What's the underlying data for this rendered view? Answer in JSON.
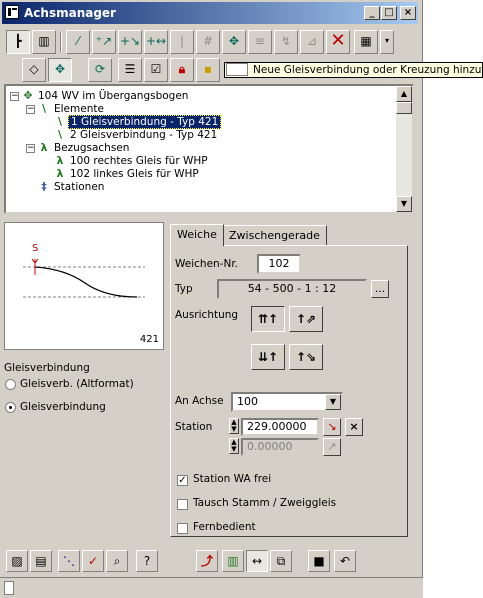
{
  "window": {
    "title": "Achsmanager",
    "caption_buttons": [
      "_",
      "□",
      "×"
    ]
  },
  "tooltip": "Neue Gleisverbindung oder Kreuzung hinzufügen",
  "tree": {
    "nodes": [
      {
        "label": "104 WV im Übergangsbogen",
        "expanded": true
      },
      {
        "label": "Elemente",
        "expanded": true
      },
      {
        "label": "1 Gleisverbindung - Typ 421",
        "selected": true
      },
      {
        "label": "2 Gleisverbindung - Typ 421"
      },
      {
        "label": "Bezugsachsen",
        "expanded": true
      },
      {
        "label": "100 rechtes Gleis für WHP"
      },
      {
        "label": "102 linkes Gleis für WHP"
      },
      {
        "label": "Stationen"
      }
    ]
  },
  "preview": {
    "marker": "S",
    "type_number": "421"
  },
  "gleisverbindung": {
    "label": "Gleisverbindung",
    "options": [
      "Gleisverb. (Altformat)",
      "Gleisverbindung"
    ],
    "selected": "Gleisverbindung"
  },
  "tabs": [
    {
      "label": "Weiche",
      "active": true
    },
    {
      "label": "Zwischengerade",
      "active": false
    }
  ],
  "form": {
    "weichen_nr_label": "Weichen-Nr.",
    "weichen_nr_value": "102",
    "typ_label": "Typ",
    "typ_value": "54 - 500 - 1 : 12",
    "typ_browse": "...",
    "ausrichtung_label": "Ausrichtung",
    "an_achse_label": "An Achse",
    "an_achse_value": "100",
    "station_label": "Station",
    "station_value": "229.00000",
    "station_value2": "0.00000",
    "checkboxes": [
      {
        "label": "Station WA frei",
        "checked": true
      },
      {
        "label": "Tausch Stamm / Zweiggleis",
        "checked": false
      },
      {
        "label": "Fernbedient",
        "checked": false
      }
    ]
  },
  "toolbar_icons": {
    "row1": [
      "tree-view-icon",
      "table-view-icon",
      "line-a-icon",
      "line-b-icon",
      "add-point-icon",
      "insert-point-icon",
      "vertical-line-icon",
      "grid-icon",
      "switch-icon",
      "parallel-icon",
      "crossing-icon",
      "angle-icon",
      "delete-icon",
      "calculator-icon",
      "dropdown-icon"
    ],
    "row2": [
      "diamond-icon",
      "new-switch-icon",
      "refresh-icon",
      "list-icon",
      "checkbox-icon",
      "lock-icon",
      "highlight-icon"
    ],
    "bottom": [
      "picture-icon",
      "document-icon",
      "connect-icon",
      "measure-icon",
      "zoom-icon",
      "help-icon",
      "route-icon",
      "layers-icon",
      "swap-icon",
      "copy-icon",
      "save-icon",
      "undo-icon"
    ]
  },
  "colors": {
    "titlebar_start": "#0a246a",
    "titlebar_end": "#a6caf0",
    "selection": "#0a246a",
    "delete_red": "#c00000"
  }
}
